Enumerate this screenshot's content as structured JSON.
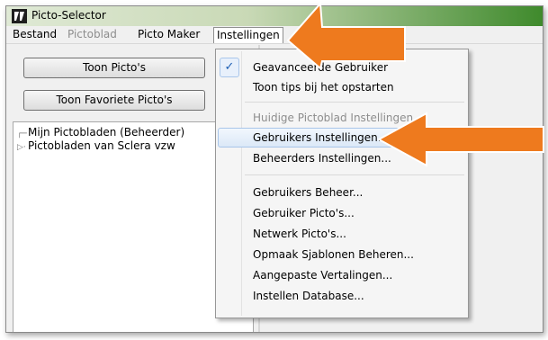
{
  "window": {
    "title": "Picto-Selector"
  },
  "menubar": {
    "items": [
      {
        "label": "Bestand"
      },
      {
        "label": "Pictoblad"
      },
      {
        "label": "Picto Maker"
      },
      {
        "label": "Instellingen"
      }
    ]
  },
  "left_panel": {
    "buttons": [
      {
        "label": "Toon Picto's"
      },
      {
        "label": "Toon Favoriete Picto's"
      }
    ],
    "tree": [
      {
        "label": "Mijn Pictobladen (Beheerder)"
      },
      {
        "label": "Pictobladen van Sclera vzw"
      }
    ]
  },
  "dropdown": {
    "items": [
      {
        "label": "Geavanceerde Gebruiker",
        "checked": true
      },
      {
        "label": "Toon tips bij het opstarten"
      },
      {
        "label": "Huidige Pictoblad Instellingen...",
        "disabled": true
      },
      {
        "label": "Gebruikers Instellingen...",
        "highlighted": true
      },
      {
        "label": "Beheerders Instellingen..."
      },
      {
        "label": "Gebruikers Beheer..."
      },
      {
        "label": "Gebruiker Picto's..."
      },
      {
        "label": "Netwerk Picto's..."
      },
      {
        "label": "Opmaak Sjablonen Beheren..."
      },
      {
        "label": "Aangepaste Vertalingen..."
      },
      {
        "label": "Instellen Database..."
      }
    ]
  },
  "colors": {
    "annotation_arrow": "#ee7a1e",
    "highlight": "#dbe8f7",
    "titlebar_accent": "#3f8a2c"
  },
  "icons": {
    "app": "picto-selector-app-icon",
    "check": "checkmark-icon",
    "arrow": "annotation-arrow-icon"
  }
}
